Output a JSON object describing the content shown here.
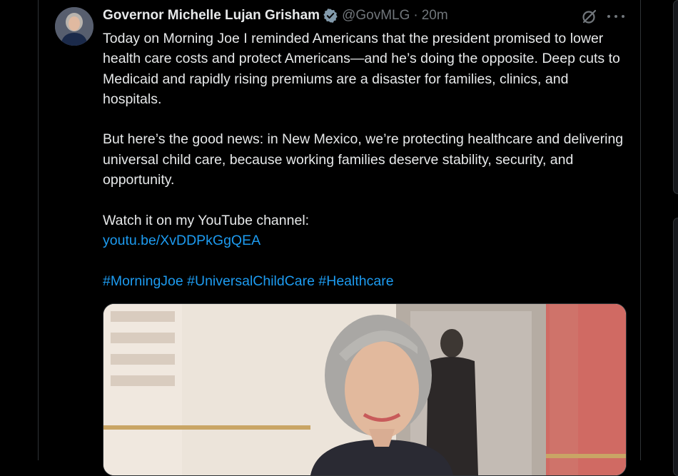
{
  "tweet": {
    "author_name": "Governor Michelle Lujan Grisham",
    "handle": "@GovMLG",
    "separator": "·",
    "time": "20m",
    "paragraph_1": "Today on Morning Joe  I reminded Americans that the president promised to lower health care costs and protect Americans—and he’s doing the opposite. Deep cuts to Medicaid and rapidly rising premiums are a disaster for families, clinics, and hospitals.",
    "paragraph_2": "But here’s the good news: in New Mexico, we’re protecting healthcare and delivering universal child care, because working families deserve stability, security, and opportunity.",
    "paragraph_3": "Watch it on my YouTube channel:",
    "link": "youtu.be/XvDDPkGgQEA",
    "hashtags": [
      "#MorningJoe",
      "#UniversalChildCare",
      "#Healthcare"
    ]
  },
  "icons": {
    "verified": "verified-badge-icon",
    "grok": "grok-icon",
    "more": "more-horizontal-icon"
  },
  "colors": {
    "background": "#000000",
    "text": "#e7e9ea",
    "muted": "#71767b",
    "accent": "#1d9bf0",
    "border": "#2f3336"
  }
}
